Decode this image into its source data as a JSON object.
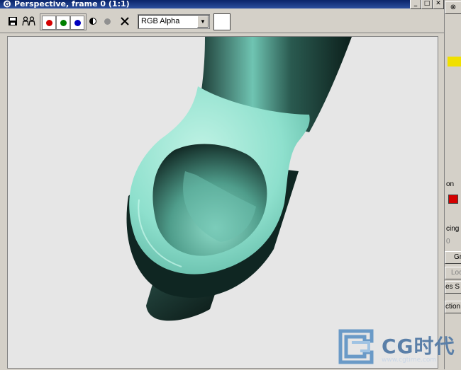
{
  "window": {
    "title": "Perspective, frame 0 (1:1)",
    "buttons": {
      "minimize": "_",
      "maximize": "□",
      "close": "✕"
    }
  },
  "toolbar": {
    "save_icon": "save-icon",
    "clone_icon": "clone-icon",
    "channels": [
      {
        "name": "red",
        "color": "#d40000"
      },
      {
        "name": "green",
        "color": "#008000"
      },
      {
        "name": "blue",
        "color": "#0000c0"
      }
    ],
    "monochrome_icon": "half-circle-icon",
    "alpha_icon": "gray-dot-icon",
    "clear_icon": "x-icon",
    "channel_select": {
      "value": "RGB Alpha"
    },
    "color_swatch": "#ffffff"
  },
  "right_panel": {
    "labels": [
      "on",
      "cing",
      "0",
      "Gr",
      "Loc",
      "es S",
      "ction"
    ],
    "accent_color": "#f0e000",
    "red_swatch": "#d40000"
  },
  "watermark": {
    "text": "CG时代",
    "url": "www.cgtime.com"
  }
}
